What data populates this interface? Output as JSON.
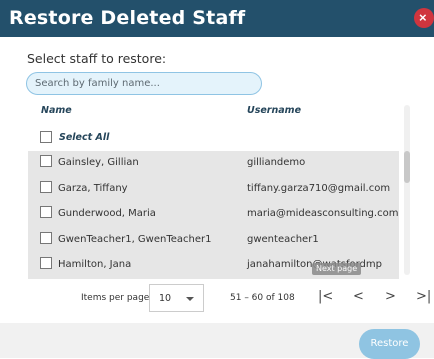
{
  "dialog": {
    "title": "Restore Deleted Staff",
    "close_icon": "close-icon",
    "close_label": "×",
    "colors": {
      "header": "#23506b",
      "close": "#d0353e",
      "accent": "#8fc4e2",
      "row_bg": "#e6e6e6"
    }
  },
  "prompt": "Select staff to restore:",
  "search": {
    "placeholder": "Search by family name...",
    "value": ""
  },
  "columns": {
    "name": "Name",
    "username": "Username"
  },
  "select_all_label": "Select All",
  "rows": [
    {
      "name": "Gainsley, Gillian",
      "username": "gilliandemo"
    },
    {
      "name": "Garza, Tiffany",
      "username": "tiffany.garza710@gmail.com"
    },
    {
      "name": "Gunderwood, Maria",
      "username": "maria@mideasconsulting.com"
    },
    {
      "name": "GwenTeacher1, GwenTeacher1",
      "username": "gwenteacher1"
    },
    {
      "name": "Hamilton, Jana",
      "username": "janahamilton@watsfordmp"
    }
  ],
  "tooltip": "Next page",
  "pagination": {
    "items_per_page_label": "Items per page:",
    "items_per_page": "10",
    "range": "51 – 60 of 108",
    "first": "|<",
    "prev": "<",
    "next": ">",
    "last": ">|"
  },
  "restore_label": "Restore"
}
